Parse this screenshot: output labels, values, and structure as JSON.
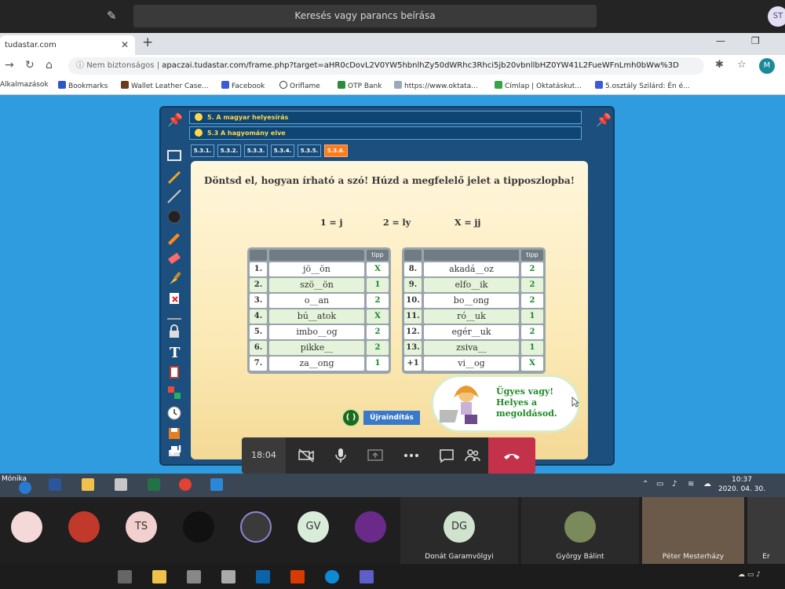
{
  "teams": {
    "search_placeholder": "Keresés vagy parancs beírása",
    "avatar_initials": "ST"
  },
  "browser": {
    "tab_title": "tudastar.com",
    "address_security": "Nem biztonságos",
    "address_url": "apaczai.tudastar.com/frame.php?target=aHR0cDovL2V0YW5hbnlhZy50dWRhc3Rhci5jb20vbnllbHZ0YW41L2FueWFnLmh0bWw%3D",
    "profile_initial": "M",
    "bookmarks": [
      "Alkalmazások",
      "Bookmarks",
      "Wallet Leather Case...",
      "Facebook",
      "Oriflame",
      "OTP Bank",
      "https://www.oktata...",
      "Címlap | Oktatáskut...",
      "5.osztály Szilárd: Én é..."
    ]
  },
  "app": {
    "breadcrumb_1": "5. A magyar helyesírás",
    "breadcrumb_2": "5.3  A hagyomány elve",
    "subtabs": [
      "5.3.1.",
      "5.3.2.",
      "5.3.3.",
      "5.3.4.",
      "5.3.5.",
      "5.3.6."
    ],
    "instruction": "Döntsd el, hogyan írható a szó! Húzd a megfelelő jelet a tipposzlopba!",
    "key": [
      "1 = j",
      "2 = ly",
      "X = jj"
    ],
    "tip_header": "tipp",
    "left_rows": [
      {
        "num": "1.",
        "word": "jö__ön",
        "tip": "X"
      },
      {
        "num": "2.",
        "word": "szö__ön",
        "tip": "1"
      },
      {
        "num": "3.",
        "word": "o__an",
        "tip": "2"
      },
      {
        "num": "4.",
        "word": "bú__atok",
        "tip": "X"
      },
      {
        "num": "5.",
        "word": "imbo__og",
        "tip": "2"
      },
      {
        "num": "6.",
        "word": "pikke__",
        "tip": "2"
      },
      {
        "num": "7.",
        "word": "za__ong",
        "tip": "1"
      }
    ],
    "right_rows": [
      {
        "num": "8.",
        "word": "akadá__oz",
        "tip": "2"
      },
      {
        "num": "9.",
        "word": "elfo__ik",
        "tip": "2"
      },
      {
        "num": "10.",
        "word": "bo__ong",
        "tip": "2"
      },
      {
        "num": "11.",
        "word": "ró__uk",
        "tip": "1"
      },
      {
        "num": "12.",
        "word": "egér__uk",
        "tip": "2"
      },
      {
        "num": "13.",
        "word": "zsiva__",
        "tip": "1"
      },
      {
        "num": "+1",
        "word": "vi__og",
        "tip": "X"
      }
    ],
    "restart_label": "Újraindítás",
    "feedback": [
      "Ügyes vagy!",
      "Helyes a",
      "megoldásod."
    ]
  },
  "meeting": {
    "duration": "18:04",
    "colors": {
      "hangup": "#c4314b"
    }
  },
  "remote_taskbar": {
    "user_label": "Mónika",
    "time": "10:37",
    "date": "2020. 04. 30."
  },
  "participants": {
    "avatars": [
      "TS",
      "GV"
    ],
    "tiles": [
      {
        "initials": "DG",
        "name": "Donát Garamvölgyi"
      },
      {
        "initials": "",
        "name": "György Bálint"
      },
      {
        "initials": "",
        "name": "Péter Mesterházy"
      },
      {
        "initials": "",
        "name": "Er"
      }
    ]
  }
}
